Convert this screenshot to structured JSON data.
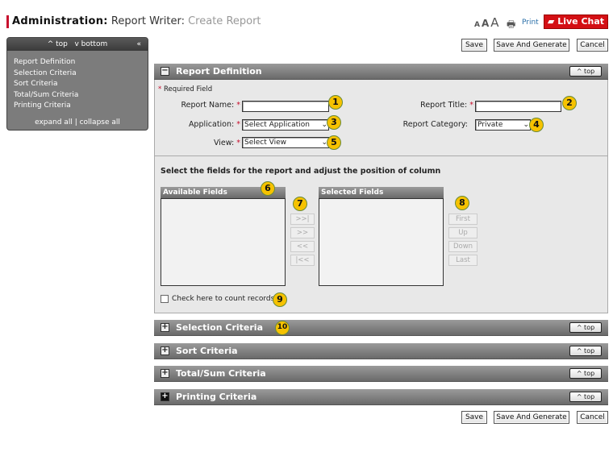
{
  "header": {
    "title_part1": "Administration:",
    "title_part2": "Report Writer:",
    "title_part3": "Create Report",
    "font_sizes": [
      "A",
      "A",
      "A"
    ],
    "print_label": "Print",
    "live_chat_label": "Live Chat"
  },
  "actions": {
    "save": "Save",
    "save_generate": "Save And Generate",
    "cancel": "Cancel"
  },
  "sidebar": {
    "top": "^ top",
    "bottom": "v bottom",
    "collapse": "«",
    "items": [
      "Report Definition",
      "Selection Criteria",
      "Sort Criteria",
      "Total/Sum Criteria",
      "Printing Criteria"
    ],
    "expand_all": "expand all",
    "collapse_all": "collapse all"
  },
  "report_definition": {
    "title": "Report Definition",
    "top": "^ top",
    "required_note": "Required Field",
    "report_name_label": "Report Name:",
    "report_name_value": "",
    "report_title_label": "Report Title:",
    "report_title_value": "",
    "application_label": "Application:",
    "application_value": "Select Application",
    "category_label": "Report Category:",
    "category_value": "Private",
    "view_label": "View:",
    "view_value": "Select View",
    "fields_instruction": "Select the fields for the report and adjust the position of column",
    "available_fields": "Available Fields",
    "selected_fields": "Selected Fields",
    "move_buttons": [
      ">>|",
      ">>",
      "<<",
      "|<<"
    ],
    "order_buttons": [
      "First",
      "Up",
      "Down",
      "Last"
    ],
    "count_records_label": "Check here to count records",
    "count_records_checked": false
  },
  "sections": [
    {
      "title": "Selection Criteria",
      "top": "^ top"
    },
    {
      "title": "Sort Criteria",
      "top": "^ top"
    },
    {
      "title": "Total/Sum Criteria",
      "top": "^ top"
    },
    {
      "title": "Printing Criteria",
      "top": "^ top"
    }
  ],
  "badges": [
    "1",
    "2",
    "3",
    "4",
    "5",
    "6",
    "7",
    "8",
    "9",
    "10"
  ],
  "colors": {
    "accent_red": "#c8102e",
    "live_chat": "#d40f14",
    "badge": "#f6c200"
  }
}
